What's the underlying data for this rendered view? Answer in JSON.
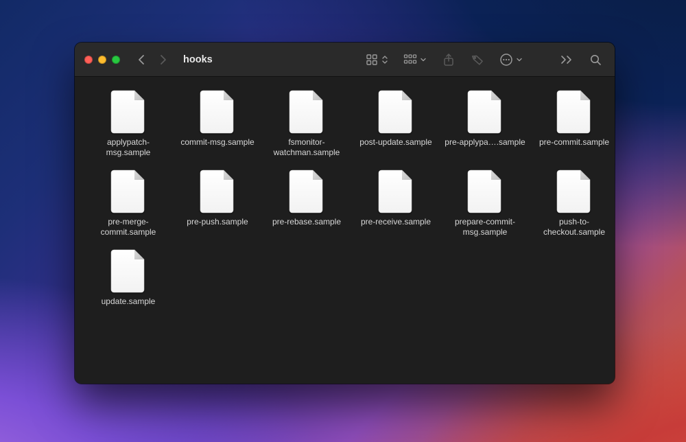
{
  "window": {
    "title": "hooks"
  },
  "files": [
    {
      "name": "applypatch-msg.sample"
    },
    {
      "name": "commit-msg.sample"
    },
    {
      "name": "fsmonitor-watchman.sample"
    },
    {
      "name": "post-update.sample"
    },
    {
      "name": "pre-applypa….sample"
    },
    {
      "name": "pre-commit.sample"
    },
    {
      "name": "pre-merge-commit.sample"
    },
    {
      "name": "pre-push.sample"
    },
    {
      "name": "pre-rebase.sample"
    },
    {
      "name": "pre-receive.sample"
    },
    {
      "name": "prepare-commit-msg.sample"
    },
    {
      "name": "push-to-checkout.sample"
    },
    {
      "name": "update.sample"
    }
  ]
}
